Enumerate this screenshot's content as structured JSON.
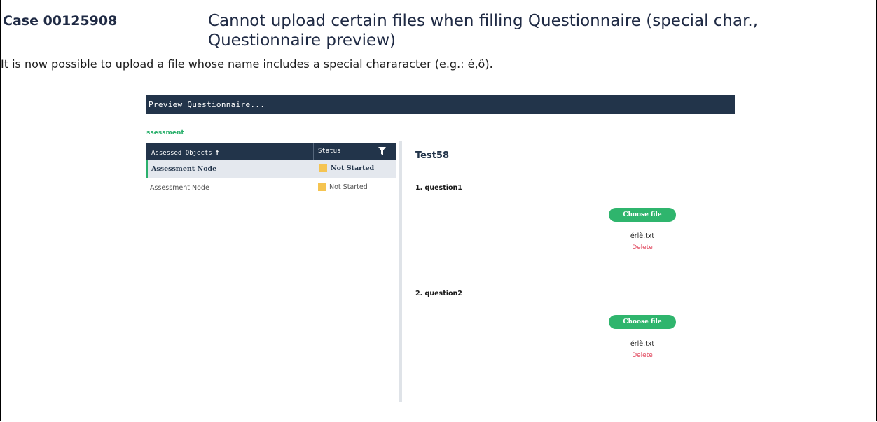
{
  "case": {
    "id": "Case 00125908",
    "title": "Cannot upload certain files when filling Questionnaire (special char., Questionnaire preview)"
  },
  "description": "It is now possible to upload a file whose name includes a special chararacter (e.g.: é,ô).",
  "preview": {
    "topbar_title": "Preview Questionnaire...",
    "section_label": "ssessment",
    "table": {
      "columns": [
        "Assessed Objects",
        "Status"
      ],
      "sort_arrow": "↑",
      "rows": [
        {
          "name": "Assessment Node",
          "status": "Not Started",
          "selected": true
        },
        {
          "name": "Assessment Node",
          "status": "Not Started",
          "selected": false
        }
      ]
    },
    "questionnaire": {
      "name": "Test58",
      "questions": [
        {
          "label": "1.  question1",
          "button": "Choose file",
          "file": "érlè.txt",
          "delete": "Delete"
        },
        {
          "label": "2.  question2",
          "button": "Choose file",
          "file": "érlè.txt",
          "delete": "Delete"
        }
      ]
    },
    "colors": {
      "header": "#22344a",
      "accent": "#2bb06c",
      "status": "#f5c451",
      "delete": "#e0435a"
    }
  }
}
